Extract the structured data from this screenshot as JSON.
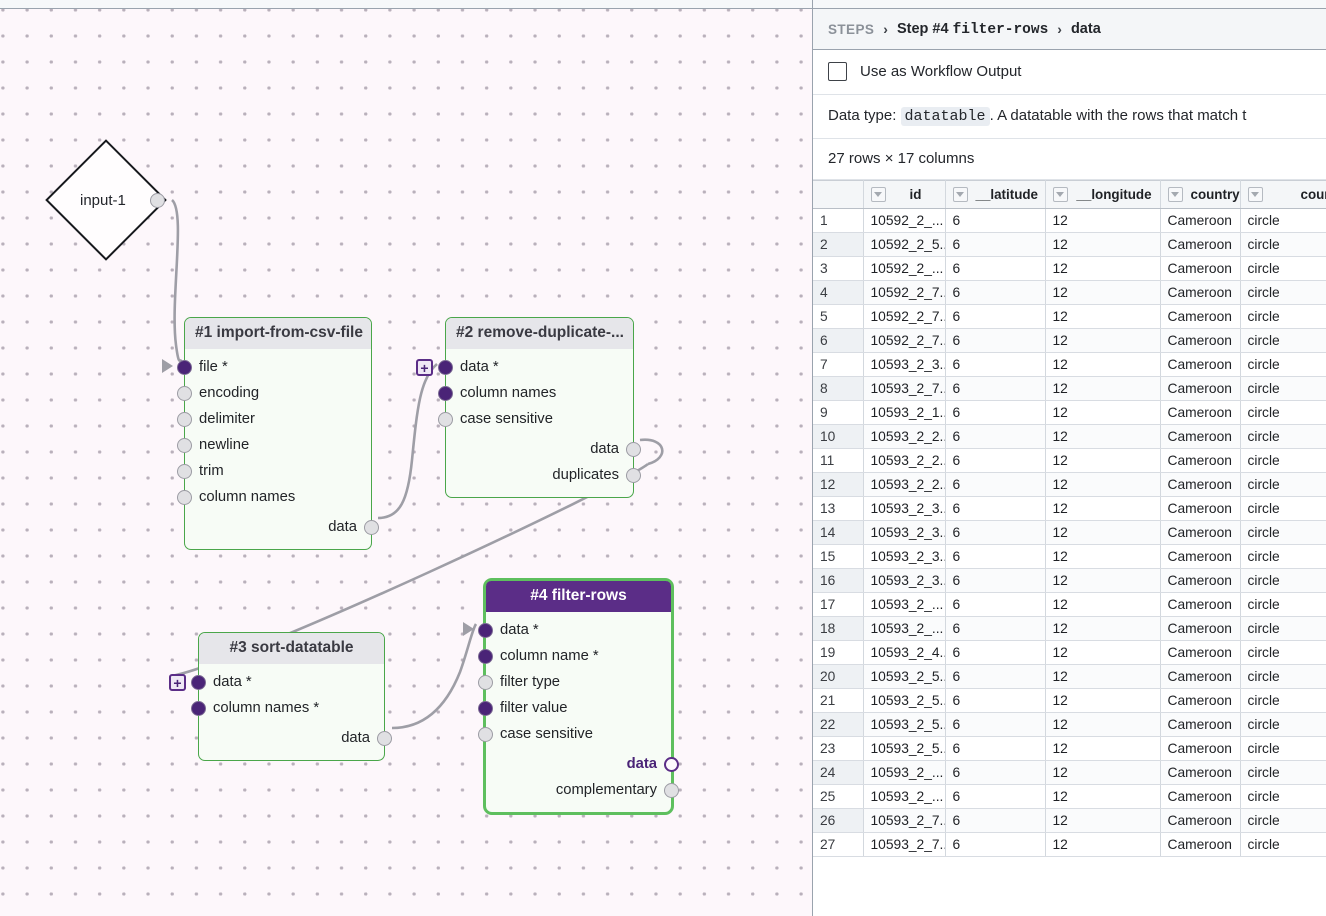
{
  "canvas": {
    "input_node": {
      "label": "input-1",
      "output_port": "out"
    },
    "nodes": [
      {
        "id": "node-1",
        "title": "#1 import-from-csv-file",
        "selected": false,
        "inputs": [
          {
            "label": "file *",
            "state": "filled",
            "badge": "arrow"
          },
          {
            "label": "encoding",
            "state": "hollow"
          },
          {
            "label": "delimiter",
            "state": "hollow"
          },
          {
            "label": "newline",
            "state": "hollow"
          },
          {
            "label": "trim",
            "state": "hollow"
          },
          {
            "label": "column names",
            "state": "hollow"
          }
        ],
        "outputs": [
          {
            "label": "data",
            "state": "hollow"
          }
        ]
      },
      {
        "id": "node-2",
        "title": "#2 remove-duplicate-...",
        "selected": false,
        "inputs": [
          {
            "label": "data *",
            "state": "filled",
            "badge": "plus"
          },
          {
            "label": "column names",
            "state": "filled"
          },
          {
            "label": "case sensitive",
            "state": "hollow"
          }
        ],
        "outputs": [
          {
            "label": "data",
            "state": "hollow"
          },
          {
            "label": "duplicates",
            "state": "hollow"
          }
        ]
      },
      {
        "id": "node-3",
        "title": "#3 sort-datatable",
        "selected": false,
        "inputs": [
          {
            "label": "data *",
            "state": "filled",
            "badge": "plus"
          },
          {
            "label": "column names *",
            "state": "filled"
          }
        ],
        "outputs": [
          {
            "label": "data",
            "state": "hollow"
          }
        ]
      },
      {
        "id": "node-4",
        "title": "#4 filter-rows",
        "selected": true,
        "inputs": [
          {
            "label": "data *",
            "state": "filled",
            "badge": "arrow"
          },
          {
            "label": "column name *",
            "state": "filled"
          },
          {
            "label": "filter type",
            "state": "hollow"
          },
          {
            "label": "filter value",
            "state": "filled"
          },
          {
            "label": "case sensitive",
            "state": "hollow"
          }
        ],
        "outputs": [
          {
            "label": "data",
            "state": "ring",
            "emphasis": true
          },
          {
            "label": "complementary",
            "state": "hollow"
          }
        ]
      }
    ],
    "colors": {
      "node_border": "#4aa64a",
      "node_selected_header": "#5b2d87",
      "port_filled": "#4a2477",
      "canvas_bg": "#fdf7fb",
      "edge": "#9e9ea6"
    }
  },
  "panel": {
    "breadcrumb": {
      "root": "STEPS",
      "sep": "›",
      "step_prefix": "Step #4",
      "step_name": "filter-rows",
      "leaf": "data"
    },
    "workflow_output": {
      "label": "Use as Workflow Output",
      "checked": false
    },
    "datatype": {
      "prefix": "Data type:",
      "type": "datatable",
      "description": ". A datatable with the rows that match t"
    },
    "dimensions": "27 rows × 17 columns",
    "table": {
      "columns": [
        "id",
        "__latitude",
        "__longitude",
        "country",
        "country__"
      ],
      "rows": [
        {
          "n": "1",
          "cells": [
            "10592_2_...",
            "6",
            "12",
            "Cameroon",
            "circle"
          ]
        },
        {
          "n": "2",
          "cells": [
            "10592_2_5...",
            "6",
            "12",
            "Cameroon",
            "circle"
          ]
        },
        {
          "n": "3",
          "cells": [
            "10592_2_...",
            "6",
            "12",
            "Cameroon",
            "circle"
          ]
        },
        {
          "n": "4",
          "cells": [
            "10592_2_7...",
            "6",
            "12",
            "Cameroon",
            "circle"
          ]
        },
        {
          "n": "5",
          "cells": [
            "10592_2_7...",
            "6",
            "12",
            "Cameroon",
            "circle"
          ]
        },
        {
          "n": "6",
          "cells": [
            "10592_2_7...",
            "6",
            "12",
            "Cameroon",
            "circle"
          ]
        },
        {
          "n": "7",
          "cells": [
            "10593_2_3...",
            "6",
            "12",
            "Cameroon",
            "circle"
          ]
        },
        {
          "n": "8",
          "cells": [
            "10593_2_7...",
            "6",
            "12",
            "Cameroon",
            "circle"
          ]
        },
        {
          "n": "9",
          "cells": [
            "10593_2_1...",
            "6",
            "12",
            "Cameroon",
            "circle"
          ]
        },
        {
          "n": "10",
          "cells": [
            "10593_2_2...",
            "6",
            "12",
            "Cameroon",
            "circle"
          ]
        },
        {
          "n": "11",
          "cells": [
            "10593_2_2...",
            "6",
            "12",
            "Cameroon",
            "circle"
          ]
        },
        {
          "n": "12",
          "cells": [
            "10593_2_2...",
            "6",
            "12",
            "Cameroon",
            "circle"
          ]
        },
        {
          "n": "13",
          "cells": [
            "10593_2_3...",
            "6",
            "12",
            "Cameroon",
            "circle"
          ]
        },
        {
          "n": "14",
          "cells": [
            "10593_2_3...",
            "6",
            "12",
            "Cameroon",
            "circle"
          ]
        },
        {
          "n": "15",
          "cells": [
            "10593_2_3...",
            "6",
            "12",
            "Cameroon",
            "circle"
          ]
        },
        {
          "n": "16",
          "cells": [
            "10593_2_3...",
            "6",
            "12",
            "Cameroon",
            "circle"
          ]
        },
        {
          "n": "17",
          "cells": [
            "10593_2_...",
            "6",
            "12",
            "Cameroon",
            "circle"
          ]
        },
        {
          "n": "18",
          "cells": [
            "10593_2_...",
            "6",
            "12",
            "Cameroon",
            "circle"
          ]
        },
        {
          "n": "19",
          "cells": [
            "10593_2_4...",
            "6",
            "12",
            "Cameroon",
            "circle"
          ]
        },
        {
          "n": "20",
          "cells": [
            "10593_2_5...",
            "6",
            "12",
            "Cameroon",
            "circle"
          ]
        },
        {
          "n": "21",
          "cells": [
            "10593_2_5...",
            "6",
            "12",
            "Cameroon",
            "circle"
          ]
        },
        {
          "n": "22",
          "cells": [
            "10593_2_5...",
            "6",
            "12",
            "Cameroon",
            "circle"
          ]
        },
        {
          "n": "23",
          "cells": [
            "10593_2_5...",
            "6",
            "12",
            "Cameroon",
            "circle"
          ]
        },
        {
          "n": "24",
          "cells": [
            "10593_2_...",
            "6",
            "12",
            "Cameroon",
            "circle"
          ]
        },
        {
          "n": "25",
          "cells": [
            "10593_2_...",
            "6",
            "12",
            "Cameroon",
            "circle"
          ]
        },
        {
          "n": "26",
          "cells": [
            "10593_2_7...",
            "6",
            "12",
            "Cameroon",
            "circle"
          ]
        },
        {
          "n": "27",
          "cells": [
            "10593_2_7...",
            "6",
            "12",
            "Cameroon",
            "circle"
          ]
        }
      ]
    }
  }
}
